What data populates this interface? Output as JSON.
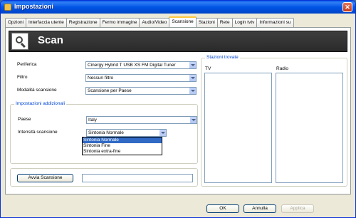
{
  "window": {
    "title": "Impostazioni",
    "close": "✕"
  },
  "tabs": [
    {
      "label": "Opzioni"
    },
    {
      "label": "Interfaccia utente"
    },
    {
      "label": "Registrazione"
    },
    {
      "label": "Fermo immagine"
    },
    {
      "label": "Audio/Video"
    },
    {
      "label": "Scansione"
    },
    {
      "label": "Stazioni"
    },
    {
      "label": "Rete"
    },
    {
      "label": "Login tvtv"
    },
    {
      "label": "Informazioni su"
    }
  ],
  "active_tab": "Scansione",
  "header": {
    "title": "Scan",
    "icon": "magnifier-icon"
  },
  "device": {
    "periferica_label": "Periferica",
    "periferica_value": "Cinergy Hybrid T USB XS FM Digital Tuner",
    "filtro_label": "Filtro",
    "filtro_value": "Nessun filtro",
    "modalita_label": "Modalità scansione",
    "modalita_value": "Scansione per Paese"
  },
  "additional": {
    "group_label": "Impostazioni addizionali",
    "paese_label": "Paese",
    "paese_value": "Italy",
    "intensita_label": "Intensità scansione",
    "intensita_value": "Sintonia Normale",
    "options": [
      "Sintonia Normale",
      "Sintonia Fine",
      "Sintonia extra-fine"
    ]
  },
  "scan": {
    "button": "Avvia Scansione",
    "status_value": ""
  },
  "found": {
    "group_label": "Stazioni trovate",
    "tv_label": "TV",
    "radio_label": "Radio"
  },
  "footer": {
    "ok": "OK",
    "cancel": "Annulla",
    "apply": "Applica"
  }
}
